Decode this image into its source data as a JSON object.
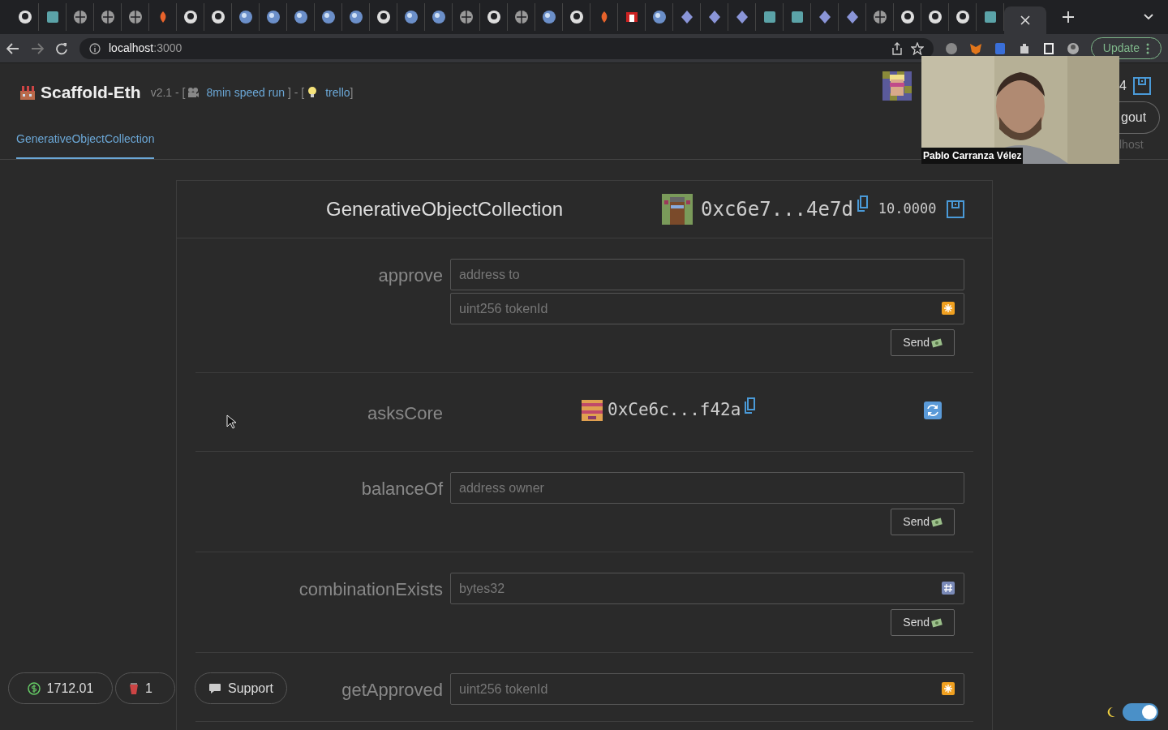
{
  "browser": {
    "url_host": "localhost",
    "url_port": ":3000",
    "update_label": "Update"
  },
  "header": {
    "title": "Scaffold-Eth",
    "version": "v2.1 - [",
    "link_1": "8min speed run",
    "sep": "] - [",
    "link_2": "trello",
    "close": "]"
  },
  "account": {
    "balance": "4",
    "logout": "gout",
    "network": "lhost"
  },
  "video": {
    "caption": "Pablo Carranza Vélez"
  },
  "nav_tabs": [
    {
      "label": "GenerativeObjectCollection",
      "selected": true
    }
  ],
  "contract": {
    "name": "GenerativeObjectCollection",
    "address": "0xc6e7...4e7d",
    "balance": "10.0000",
    "functions": [
      {
        "kind": "write",
        "name": "approve",
        "inputs": [
          {
            "placeholder": "address to",
            "kind": "address"
          },
          {
            "placeholder": "uint256 tokenId",
            "kind": "number"
          }
        ],
        "send": "Send"
      },
      {
        "kind": "read",
        "name": "asksCore",
        "value": "0xCe6c...f42a"
      },
      {
        "kind": "write",
        "name": "balanceOf",
        "inputs": [
          {
            "placeholder": "address owner",
            "kind": "address"
          }
        ],
        "send": "Send"
      },
      {
        "kind": "write",
        "name": "combinationExists",
        "inputs": [
          {
            "placeholder": "bytes32",
            "kind": "bytes"
          }
        ],
        "send": "Send"
      },
      {
        "kind": "write",
        "name": "getApproved",
        "inputs": [
          {
            "placeholder": "uint256 tokenId",
            "kind": "number"
          }
        ]
      }
    ]
  },
  "footer": {
    "gas": "1712.01",
    "faucet": "1",
    "support": "Support",
    "dark_mode": true
  }
}
